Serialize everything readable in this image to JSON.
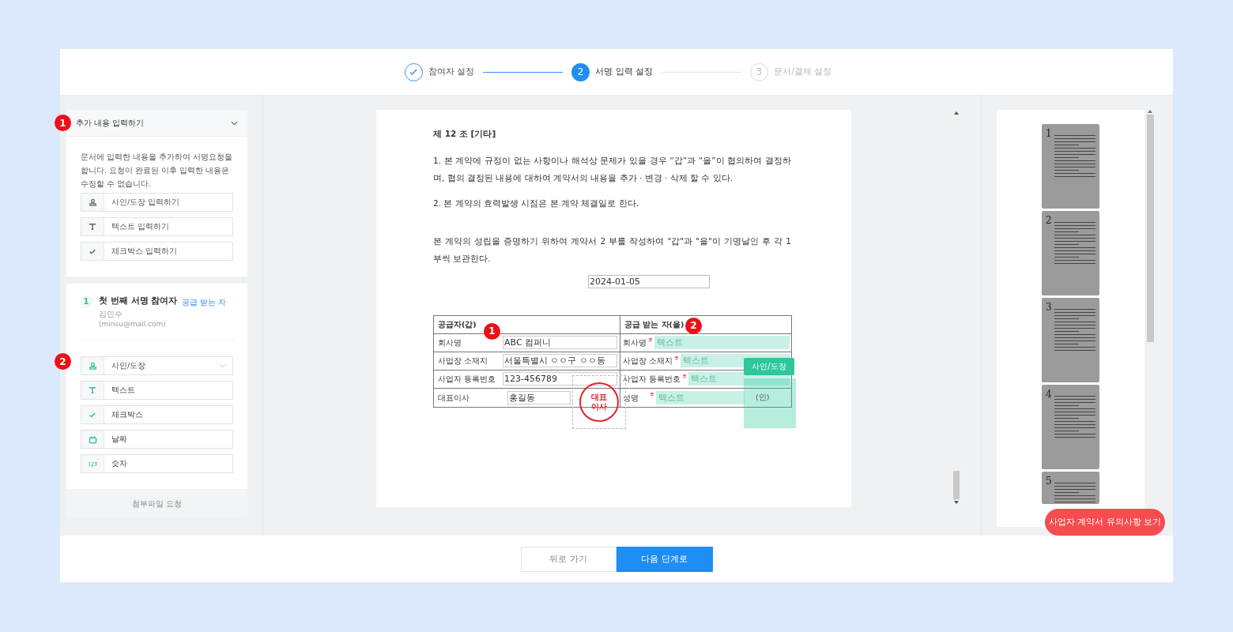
{
  "steps": [
    {
      "label": "참여자 설정",
      "completed": true,
      "selected": false
    },
    {
      "label": "서명 입력 설정",
      "completed": false,
      "selected": true,
      "number": "2"
    },
    {
      "label": "문서/결제 설정",
      "completed": false,
      "selected": false,
      "number": "3"
    }
  ],
  "extra_section": {
    "marker": "1",
    "title": "추가 내용 입력하기",
    "expanded": true,
    "description": "문서에 입력한 내용을 추가하여 서명요청을 합니다. 요청이 완료된 이후 입력한 내용은 수정할 수 없습니다.",
    "tools": [
      {
        "kind": "stamp",
        "label": "사인/도장 입력하기"
      },
      {
        "kind": "text",
        "label": "텍스트 입력하기"
      },
      {
        "kind": "check",
        "label": "체크박스 입력하기"
      }
    ]
  },
  "participant": {
    "number": "1",
    "title": "첫 번째 서명 참여자",
    "role": "공급 받는 자",
    "name": "김민수",
    "email": "(minsu@mail.com)",
    "marker": "2",
    "tools": [
      {
        "kind": "stamp",
        "label": "사인/도장",
        "dropdown": true
      },
      {
        "kind": "text",
        "label": "텍스트",
        "dropdown": false
      },
      {
        "kind": "check",
        "label": "체크박스",
        "dropdown": false
      },
      {
        "kind": "date",
        "label": "날짜",
        "dropdown": false
      },
      {
        "kind": "number",
        "label": "숫자",
        "dropdown": false
      }
    ],
    "attachment": "첨부파일 요청"
  },
  "document": {
    "heading": "제 12 조 [기타]",
    "paragraphs": [
      "1. 본 계약에 규정이 없는 사항이나 해석상 문제가 있을 경우 “갑”과 “을”이 협의하여 결정하며, 협의 결정된 내용에 대하여 계약서의 내용을 추가 · 변경 · 삭제 할 수 있다.",
      "2. 본 계약의 효력발생 시점은 본 계약 체결일로 한다.",
      "본 계약의 성립을 증명하기 위하여 계약서 2 부를 작성하여 \"갑\"과 \"을\"이 기명날인 후 각 1 부씩 보관한다."
    ],
    "date": "2024-01-05",
    "supplier": {
      "heading": "공급자(갑)",
      "marker": "1",
      "rows": [
        {
          "label": "회사명",
          "value": "ABC 컴퍼니"
        },
        {
          "label": "사업장 소재지",
          "value": "서울특별시 ㅇㅇ구 ㅇㅇ동"
        },
        {
          "label": "사업자 등록번호",
          "value": "123-456789"
        },
        {
          "label": "대표이사",
          "value": "홍길동"
        }
      ],
      "stamp": "대표이사"
    },
    "receiver": {
      "heading": "공급 받는 자(을)",
      "marker": "2",
      "rows": [
        {
          "label": "회사명",
          "placeholder": "텍스트",
          "required": true
        },
        {
          "label": "사업장 소재지",
          "placeholder": "텍스트",
          "required": true
        },
        {
          "label": "사업자 등록번호",
          "placeholder": "텍스트",
          "required": true
        },
        {
          "label": "성명",
          "placeholder": "텍스트",
          "required": true
        }
      ],
      "seal_label": "(인)",
      "sign_tooltip": "사인/도장"
    }
  },
  "pages": [
    "1",
    "2",
    "3",
    "4",
    "5"
  ],
  "notice_button": "사업자 계약서 유의사항 보기",
  "buttons": {
    "back": "뒤로 가기",
    "next": "다음 단계로"
  }
}
